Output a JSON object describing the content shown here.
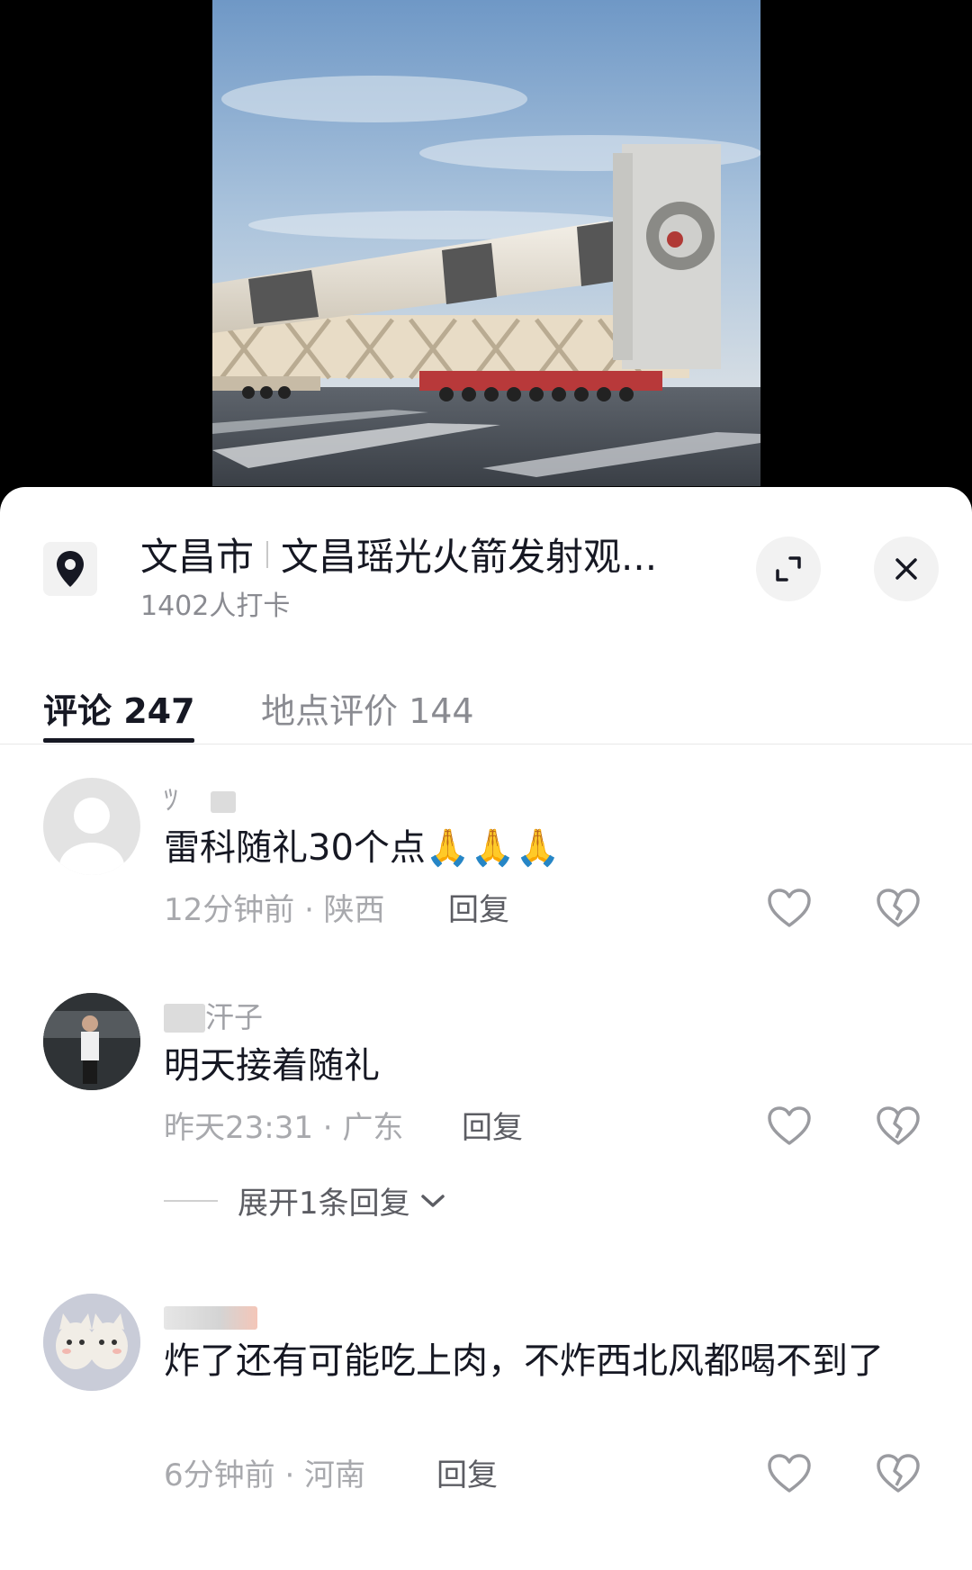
{
  "location": {
    "city": "文昌市",
    "place": "文昌瑶光火箭发射观...",
    "checkins": "1402人打卡"
  },
  "tabs": [
    {
      "label": "评论 247"
    },
    {
      "label": "地点评价 144"
    }
  ],
  "comments": [
    {
      "username": "ﾂ",
      "text": "雷科随礼30个点🙏🙏🙏",
      "time": "12分钟前 · 陕西",
      "reply": "回复"
    },
    {
      "username": "汗子",
      "text": "明天接着随礼",
      "time": "昨天23:31 · 广东",
      "reply": "回复",
      "expand": "展开1条回复"
    },
    {
      "username": "",
      "text": "炸了还有可能吃上肉，不炸西北风都喝不到了",
      "time": "6分钟前 · 河南",
      "reply": "回复"
    }
  ]
}
